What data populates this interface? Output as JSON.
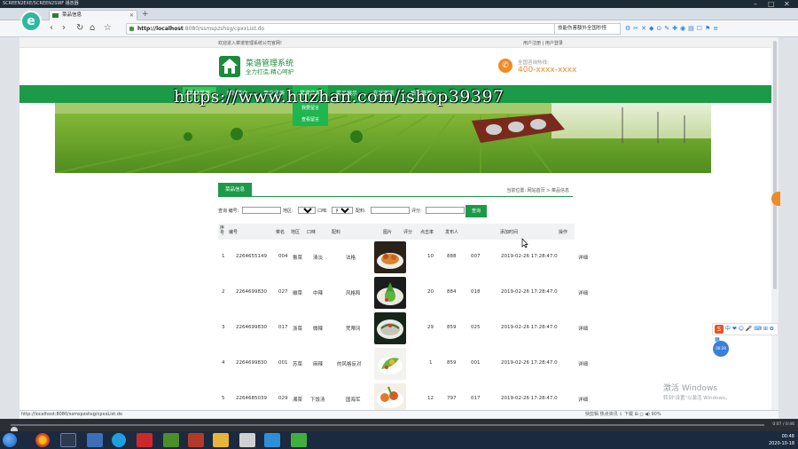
{
  "window": {
    "title": "SCREEN2EXE/SCREEN2SWF 播放器"
  },
  "browser": {
    "tab_title": "菜品信息",
    "url_host": "http://localhost",
    "url_path": ":8080/ssmspzshsg/cpxxList.do",
    "search_placeholder": "技能伤害额外全国秒怪",
    "status_url": "http://localhost:8080/ssmspzshsg/cpxxList.do",
    "status_right": "快剪辑   热点资讯   ⇩   下载   ⊞   ◻   ◀)   90%"
  },
  "site": {
    "welcome": "欢迎进入菜谱管理系统公司官网!",
    "user_register": "用户注册",
    "user_login": "用户登录",
    "title": "菜谱管理系统",
    "slogan": "全力打造,精心呵护",
    "hotline_label": "全国咨询热线:",
    "hotline_number": "400-xxxx-xxxx",
    "watermark": "https://www.huzhan.com/ishop39397"
  },
  "nav": {
    "items": [
      "网站首页",
      "系统简介",
      "用户注册",
      "菜谱信息",
      "菜品展示",
      "在线留言",
      "后台管理"
    ],
    "dropdown": [
      "我要留言",
      "查看留言"
    ]
  },
  "panel": {
    "tab": "菜品信息",
    "breadcrumb": "当前位置: 网站首页 > 菜品信息"
  },
  "filters": {
    "code_label": "查询 编号:",
    "region_label": "地区:",
    "region_value": "所有",
    "taste_label": "口味:",
    "taste_value": "所有",
    "ingredient_label": "配料:",
    "score_label": "评分:",
    "query_button": "查询"
  },
  "table": {
    "headers": {
      "seq": "序号",
      "code": "编号",
      "name": "菜名",
      "region": "地区",
      "taste": "口味",
      "ingredient": "配料",
      "image": "图片",
      "score": "评分",
      "hits": "点击率",
      "publisher": "发布人",
      "added": "添加时间",
      "action": "操作"
    },
    "rows": [
      {
        "seq": "1",
        "code": "2264655149",
        "name": "004",
        "region": "鲁菜",
        "taste": "清淡",
        "ingredient": "法格",
        "score": "10",
        "hits": "888",
        "publisher": "007",
        "added": "2019-02-26 17:28:47.0",
        "action": "详细"
      },
      {
        "seq": "2",
        "code": "2264699830",
        "name": "027",
        "region": "徽菜",
        "taste": "中辣",
        "ingredient": "风格和",
        "score": "20",
        "hits": "884",
        "publisher": "018",
        "added": "2019-02-26 17:28:47.0",
        "action": "详细"
      },
      {
        "seq": "3",
        "code": "2264699830",
        "name": "017",
        "region": "浙菜",
        "taste": "微辣",
        "ingredient": "梵蒂冈",
        "score": "29",
        "hits": "859",
        "publisher": "025",
        "added": "2019-02-26 17:28:47.0",
        "action": "详细"
      },
      {
        "seq": "4",
        "code": "2264699830",
        "name": "001",
        "region": "苏菜",
        "taste": "麻辣",
        "ingredient": "的风格反对",
        "score": "1",
        "hits": "859",
        "publisher": "001",
        "added": "2019-02-26 17:28:47.0",
        "action": "详细"
      },
      {
        "seq": "5",
        "code": "2264685039",
        "name": "029",
        "region": "湘菜",
        "taste": "下饭汤",
        "ingredient": "国海军",
        "score": "12",
        "hits": "797",
        "publisher": "017",
        "added": "2019-02-26 17:28:47.0",
        "action": "详细"
      }
    ]
  },
  "overlay": {
    "activate_title": "激活 Windows",
    "activate_sub": "转到\"设置\"以激活 Windows。",
    "ime": "中 ❤ ☺ 🎤 ⌨ ⊞ ✿ ▦",
    "float_button": "00:28"
  },
  "player": {
    "time": "0:07 / 0:46"
  },
  "taskbar": {
    "time": "00:48",
    "date": "2020-10-18"
  },
  "colors": {
    "accent": "#1b9a48",
    "highlight": "#38c75a",
    "hotline": "#f08a24"
  }
}
